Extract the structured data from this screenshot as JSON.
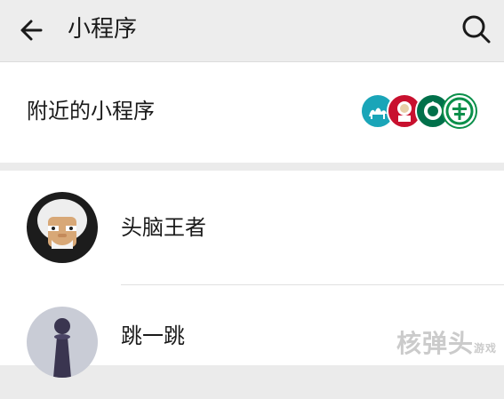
{
  "header": {
    "title": "小程序",
    "back_icon": "arrow-left-icon",
    "search_icon": "search-icon"
  },
  "nearby": {
    "label": "附近的小程序",
    "logos": [
      "camel-logo",
      "kfc-logo",
      "starbucks-logo",
      "bank-logo"
    ]
  },
  "apps": [
    {
      "name": "头脑王者",
      "icon": "old-man-avatar"
    },
    {
      "name": "跳一跳",
      "icon": "chess-piece-avatar"
    }
  ],
  "watermark": {
    "text": "核弹头",
    "sub": "游戏"
  },
  "colors": {
    "header_bg": "#ededed",
    "page_bg": "#ebebeb",
    "row_bg": "#ffffff",
    "teal": "#1aa5b8",
    "kfc_red": "#c8102e",
    "starbucks_green": "#00704a",
    "bank_green": "#0a8f4a"
  }
}
